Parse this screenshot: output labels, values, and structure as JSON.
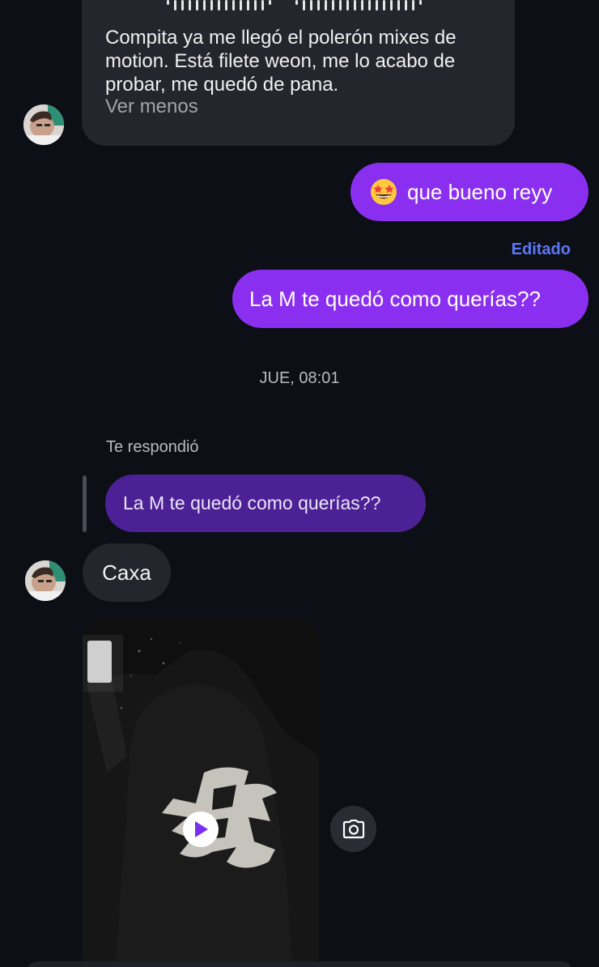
{
  "messages": {
    "voice_note": {
      "transcript": "Compita ya me llegó el polerón mixes de motion. Está filete weon, me lo acabo de probar, me quedó de pana.",
      "toggle_label": "Ver menos"
    },
    "outgoing_1": {
      "emoji": "star-struck-emoji",
      "text": "que bueno reyy"
    },
    "edited_label": "Editado",
    "outgoing_2": {
      "text": "La M te quedó como querías??"
    },
    "timestamp": "JUE, 08:01",
    "reply": {
      "label": "Te respondió",
      "quoted_text": "La M te quedó como querías??"
    },
    "incoming_reply": {
      "text": "Caxa"
    },
    "media": {
      "type": "video",
      "play_icon": "play-icon",
      "camera_icon": "camera-icon"
    }
  },
  "colors": {
    "background": "#0d0f17",
    "outgoing_bubble": "#8a2ff0",
    "incoming_bubble": "#24262e",
    "quoted_bubble": "#4c2195",
    "edited_label": "#5b78f5",
    "play_icon": "#7b2ff2"
  }
}
